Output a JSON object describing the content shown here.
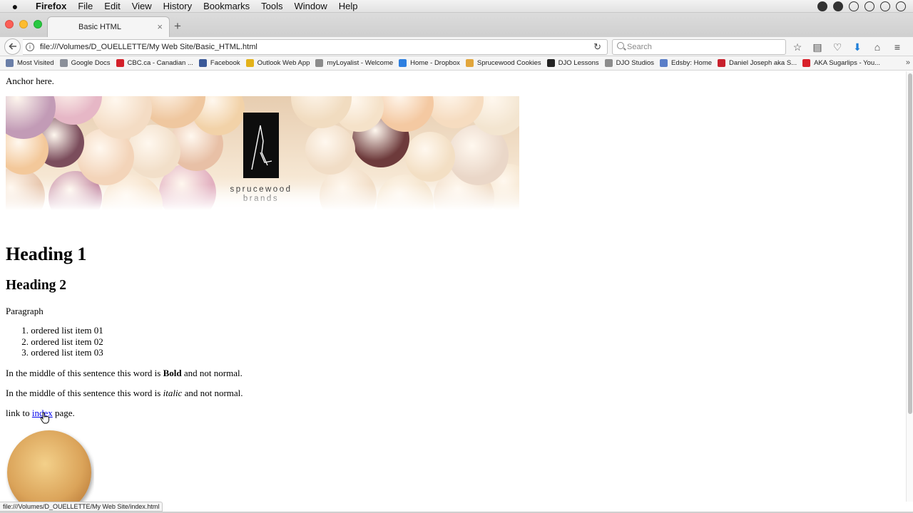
{
  "menubar": {
    "app": "Firefox",
    "items": [
      "File",
      "Edit",
      "View",
      "History",
      "Bookmarks",
      "Tools",
      "Window",
      "Help"
    ]
  },
  "tab": {
    "title": "Basic HTML",
    "close": "×"
  },
  "newtab": "+",
  "navbar": {
    "url": "file:///Volumes/D_OUELLETTE/My Web Site/Basic_HTML.html",
    "search_placeholder": "Search"
  },
  "bookmarks": [
    {
      "label": "Most Visited",
      "color": "#6b7fa8"
    },
    {
      "label": "Google Docs",
      "color": "#8a8f99"
    },
    {
      "label": "CBC.ca - Canadian ...",
      "color": "#d4202a"
    },
    {
      "label": "Facebook",
      "color": "#3b5998"
    },
    {
      "label": "Outlook Web App",
      "color": "#e3b21a"
    },
    {
      "label": "myLoyalist - Welcome",
      "color": "#8c8c8c"
    },
    {
      "label": "Home - Dropbox",
      "color": "#2d7fe0"
    },
    {
      "label": "Sprucewood Cookies",
      "color": "#e2a63c"
    },
    {
      "label": "DJO Lessons",
      "color": "#222222"
    },
    {
      "label": "DJO Studios",
      "color": "#8c8c8c"
    },
    {
      "label": "Edsby: Home",
      "color": "#5a7ec8"
    },
    {
      "label": "Daniel Joseph aka S...",
      "color": "#c8202c"
    },
    {
      "label": "AKA Sugarlips - You...",
      "color": "#d8202a"
    }
  ],
  "content": {
    "anchor": "Anchor here.",
    "logo_line1": "sprucewood",
    "logo_line2": "brands",
    "heading1": "Heading 1",
    "heading2": "Heading 2",
    "paragraph": "Paragraph",
    "list": [
      "ordered list item 01",
      "ordered list item 02",
      "ordered list item 03"
    ],
    "bold_sentence": {
      "before": "In the middle of this sentence this word is ",
      "word": "Bold",
      "after": " and not normal."
    },
    "italic_sentence": {
      "before": "In the middle of this sentence this word is ",
      "word": "italic",
      "after": " and not normal."
    },
    "link_sentence": {
      "before": "link to ",
      "link": "index",
      "after": " page."
    }
  },
  "status_url": "file:///Volumes/D_OUELLETTE/My Web Site/index.html"
}
